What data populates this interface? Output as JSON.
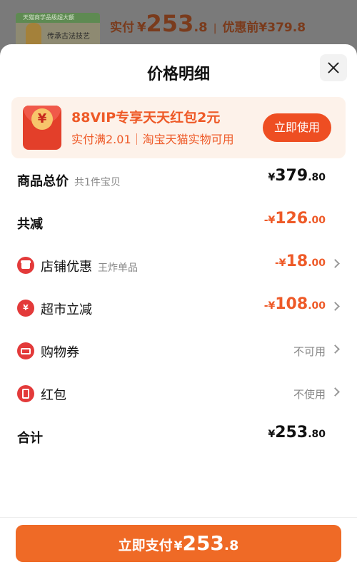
{
  "background_product": {
    "thumb_band_text": "天猫商学品级超大额",
    "thumb_text": "传承古法技艺",
    "price_label": "实付",
    "price_currency": "¥",
    "price_int": "253",
    "price_dec": ".8",
    "separator": "|",
    "original_label": "优惠前¥379.8"
  },
  "sheet": {
    "title": "价格明细",
    "close_icon": "close-icon"
  },
  "vip_banner": {
    "envelope_symbol": "¥",
    "title": "88VIP专享天天红包2元",
    "subtitle": "实付满2.01｜淘宝天猫实物可用",
    "button_label": "立即使用"
  },
  "rows": {
    "total": {
      "label": "商品总价",
      "sub": "共1件宝贝",
      "currency": "¥",
      "int": "379",
      "dec": ".80"
    },
    "reduction": {
      "label": "共减",
      "prefix": "-¥",
      "int": "126",
      "dec": ".00"
    },
    "store": {
      "icon": "store-icon",
      "label": "店铺优惠",
      "sub": "王炸单品",
      "prefix": "-¥",
      "int": "18",
      "dec": ".00"
    },
    "supermarket": {
      "icon": "yuan-coin-icon",
      "icon_symbol": "¥",
      "label": "超市立减",
      "prefix": "-¥",
      "int": "108",
      "dec": ".00"
    },
    "coupon": {
      "icon": "ticket-icon",
      "label": "购物券",
      "status": "不可用"
    },
    "red_packet": {
      "icon": "red-packet-icon",
      "label": "红包",
      "status": "不使用"
    },
    "sum": {
      "label": "合计",
      "currency": "¥",
      "int": "253",
      "dec": ".80"
    }
  },
  "pay_button": {
    "label": "立即支付",
    "currency": "¥",
    "int": "253",
    "dec": ".8"
  },
  "colors": {
    "accent_orange": "#ee5a28",
    "pay_button": "#ef6a26",
    "icon_red": "#e33a3a"
  }
}
